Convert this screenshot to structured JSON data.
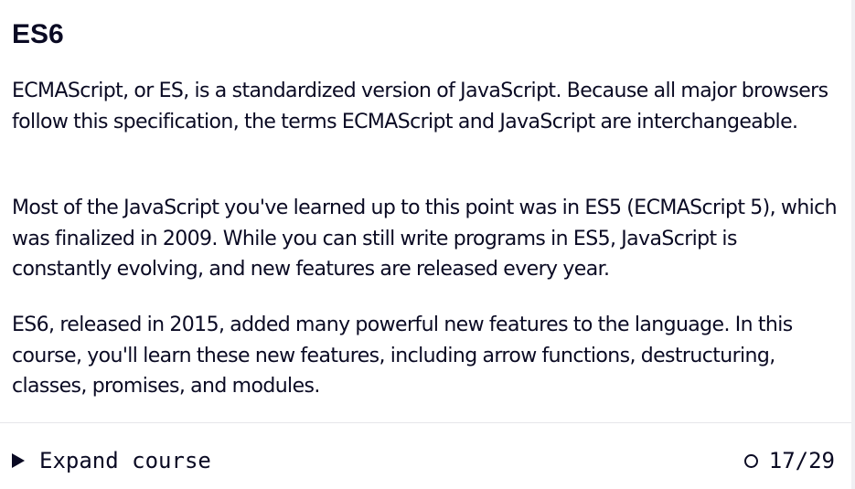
{
  "section": {
    "title": "ES6",
    "paragraphs": [
      "ECMAScript, or ES, is a standardized version of JavaScript. Because all major browsers follow this specification, the terms ECMAScript and JavaScript are interchangeable.",
      "Most of the JavaScript you've learned up to this point was in ES5 (ECMAScript 5), which was finalized in 2009. While you can still write programs in ES5, JavaScript is constantly evolving, and new features are released every year.",
      "ES6, released in 2015, added many powerful new features to the language. In this course, you'll learn these new features, including arrow functions, destructuring, classes, promises, and modules."
    ]
  },
  "footer": {
    "expand_label": "Expand course",
    "expand_icon": "triangle-right-icon",
    "progress_icon": "circle-icon",
    "progress_text": "17/29",
    "progress_completed": 17,
    "progress_total": 29
  },
  "colors": {
    "text": "#0a0a23",
    "background": "#ffffff",
    "divider": "#e6e6ea"
  }
}
